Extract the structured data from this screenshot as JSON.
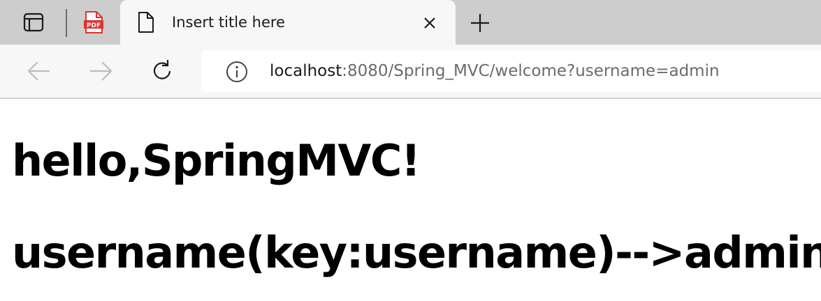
{
  "browser": {
    "tabs": [
      {
        "kind": "pdf",
        "icon": "pdf-icon"
      },
      {
        "kind": "page",
        "title": "Insert title here",
        "active": true,
        "icon": "page-icon"
      }
    ],
    "new_tab_icon": "plus-icon",
    "close_icon": "close-icon",
    "toolbar": {
      "back_icon": "back-arrow-icon",
      "forward_icon": "forward-arrow-icon",
      "refresh_icon": "refresh-icon",
      "info_icon": "info-icon"
    },
    "address": {
      "host": "localhost",
      "rest": ":8080/Spring_MVC/welcome?username=admin"
    }
  },
  "page": {
    "greeting": "hello,SpringMVC!",
    "username_line": "username(key:username)-->admin"
  },
  "colors": {
    "tabstrip_bg": "#cdcdcd",
    "toolbar_bg": "#f7f7f7",
    "pdf_red": "#e0312d"
  }
}
